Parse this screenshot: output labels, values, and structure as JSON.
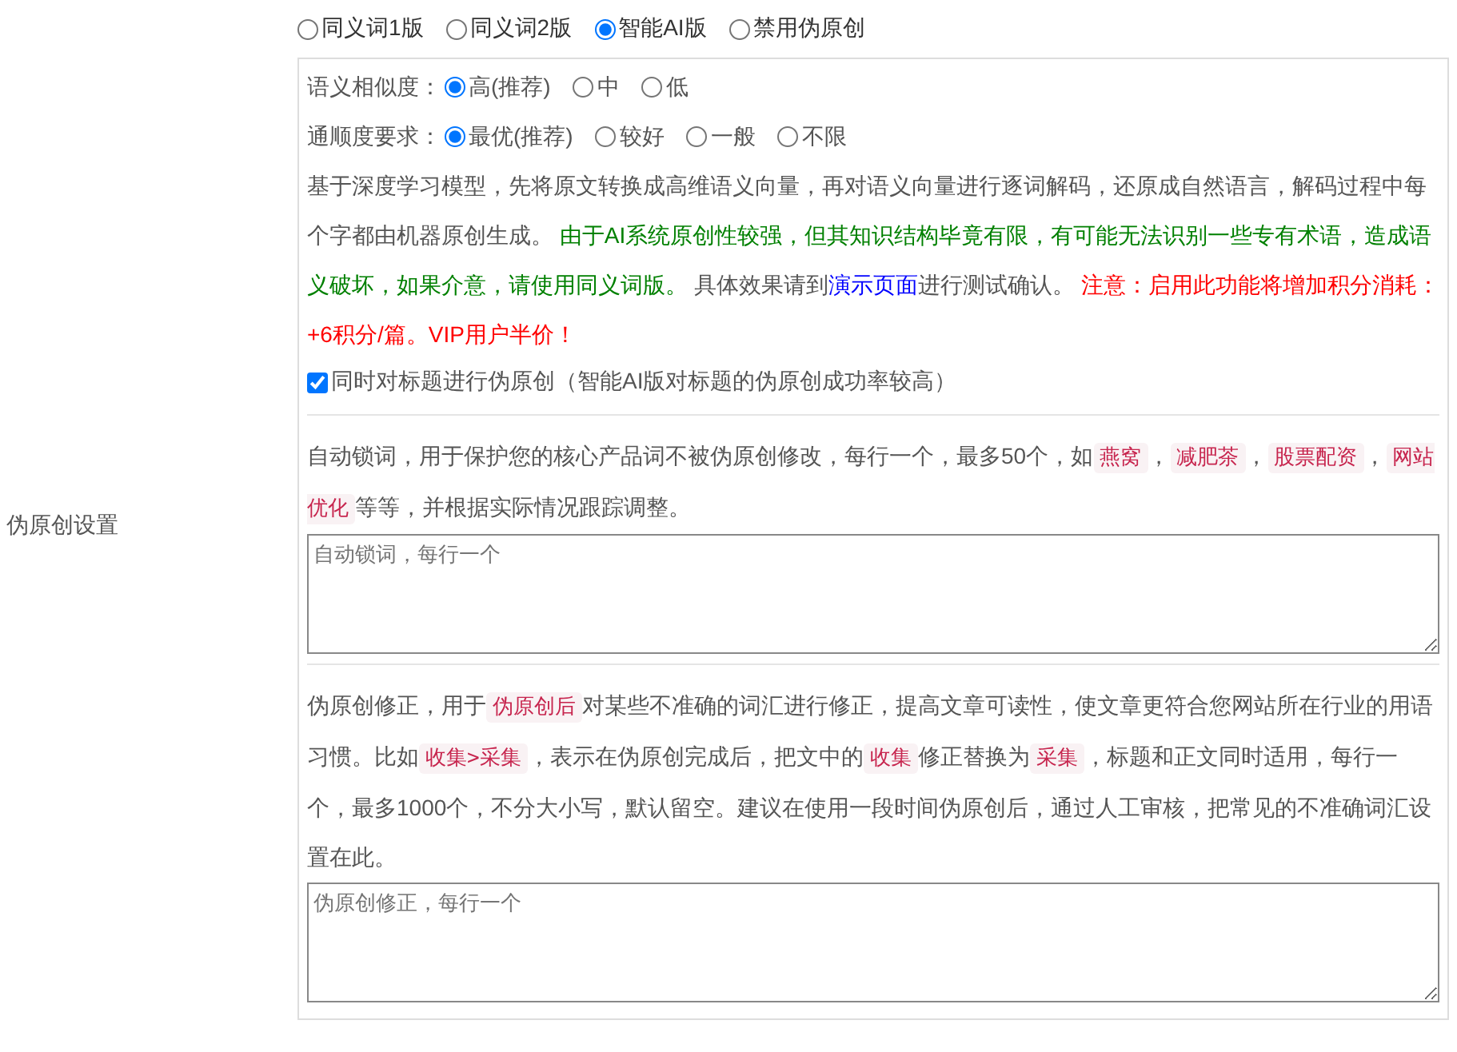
{
  "side_label": "伪原创设置",
  "modes": [
    {
      "label": "同义词1版",
      "selected": false
    },
    {
      "label": "同义词2版",
      "selected": false
    },
    {
      "label": "智能AI版",
      "selected": true
    },
    {
      "label": "禁用伪原创",
      "selected": false
    }
  ],
  "similarity": {
    "label": "语义相似度：",
    "options": [
      {
        "label": "高(推荐)",
        "selected": true
      },
      {
        "label": "中",
        "selected": false
      },
      {
        "label": "低",
        "selected": false
      }
    ]
  },
  "fluency": {
    "label": "通顺度要求：",
    "options": [
      {
        "label": "最优(推荐)",
        "selected": true
      },
      {
        "label": "较好",
        "selected": false
      },
      {
        "label": "一般",
        "selected": false
      },
      {
        "label": "不限",
        "selected": false
      }
    ]
  },
  "description": [
    {
      "kind": "text",
      "text": "基于深度学习模型，先将原文转换成高维语义向量，再对语义向量进行逐词解码，还原成自然语言，解码过程中每个字都由机器原创生成。 "
    },
    {
      "kind": "success",
      "text": "由于AI系统原创性较强，但其知识结构毕竟有限，有可能无法识别一些专有术语，造成语义破坏，如果介意，请使用同义词版。"
    },
    {
      "kind": "text",
      "text": " 具体效果请到"
    },
    {
      "kind": "link",
      "text": "演示页面"
    },
    {
      "kind": "text",
      "text": "进行测试确认。 "
    },
    {
      "kind": "warning",
      "text": "注意：启用此功能将增加积分消耗：+6积分/篇。VIP用户半价！"
    }
  ],
  "title_option": {
    "label": "同时对标题进行伪原创（智能AI版对标题的伪原创成功率较高）",
    "checked": true
  },
  "lock_words": {
    "help": [
      {
        "kind": "text",
        "text": "自动锁词，用于保护您的核心产品词不被伪原创修改，每行一个，最多50个，如"
      },
      {
        "kind": "code",
        "text": "燕窝"
      },
      {
        "kind": "text",
        "text": "，"
      },
      {
        "kind": "code",
        "text": "减肥茶"
      },
      {
        "kind": "text",
        "text": "，"
      },
      {
        "kind": "code",
        "text": "股票配资"
      },
      {
        "kind": "text",
        "text": "，"
      },
      {
        "kind": "code",
        "text": "网站优化"
      },
      {
        "kind": "text",
        "text": "等等，并根据实际情况跟踪调整。"
      }
    ],
    "placeholder": "自动锁词，每行一个"
  },
  "correction": {
    "help": [
      {
        "kind": "text",
        "text": "伪原创修正，用于"
      },
      {
        "kind": "code",
        "text": "伪原创后"
      },
      {
        "kind": "text",
        "text": "对某些不准确的词汇进行修正，提高文章可读性，使文章更符合您网站所在行业的用语习惯。比如"
      },
      {
        "kind": "code",
        "text": "收集>采集"
      },
      {
        "kind": "text",
        "text": "，表示在伪原创完成后，把文中的"
      },
      {
        "kind": "code",
        "text": "收集"
      },
      {
        "kind": "text",
        "text": "修正替换为"
      },
      {
        "kind": "code",
        "text": "采集"
      },
      {
        "kind": "text",
        "text": "，标题和正文同时适用，每行一个，最多1000个，不分大小写，默认留空。建议在使用一段时间伪原创后，通过人工审核，把常见的不准确词汇设置在此。"
      }
    ],
    "placeholder": "伪原创修正，每行一个"
  }
}
